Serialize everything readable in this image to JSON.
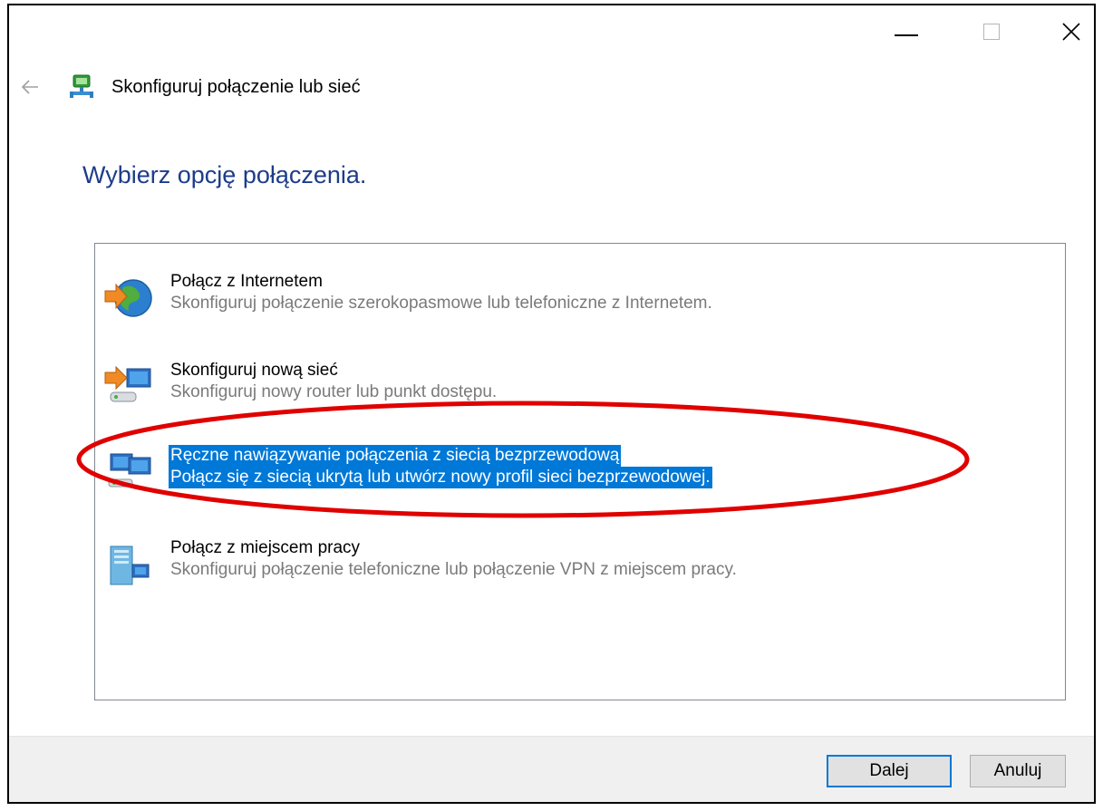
{
  "window": {
    "controls": {
      "minimize": "minimize-icon",
      "maximize": "maximize-icon",
      "close": "close-icon"
    }
  },
  "header": {
    "back_icon": "back-arrow-icon",
    "title": "Skonfiguruj połączenie lub sieć"
  },
  "main": {
    "heading": "Wybierz opcję połączenia.",
    "options": [
      {
        "title": "Połącz z Internetem",
        "description": "Skonfiguruj połączenie szerokopasmowe lub telefoniczne z Internetem.",
        "icon": "globe-connect-icon",
        "selected": false
      },
      {
        "title": "Skonfiguruj nową sieć",
        "description": "Skonfiguruj nowy router lub punkt dostępu.",
        "icon": "new-network-icon",
        "selected": false
      },
      {
        "title": "Ręczne nawiązywanie połączenia z siecią bezprzewodową",
        "description": "Połącz się z siecią ukrytą lub utwórz nowy profil sieci bezprzewodowej.",
        "icon": "wireless-network-icon",
        "selected": true
      },
      {
        "title": "Połącz z miejscem pracy",
        "description": "Skonfiguruj połączenie telefoniczne lub połączenie VPN z miejscem pracy.",
        "icon": "workplace-icon",
        "selected": false
      }
    ]
  },
  "footer": {
    "next_label": "Dalej",
    "cancel_label": "Anuluj"
  },
  "colors": {
    "heading": "#1d3c8a",
    "selection": "#0078d7",
    "annotation": "#e00000"
  }
}
